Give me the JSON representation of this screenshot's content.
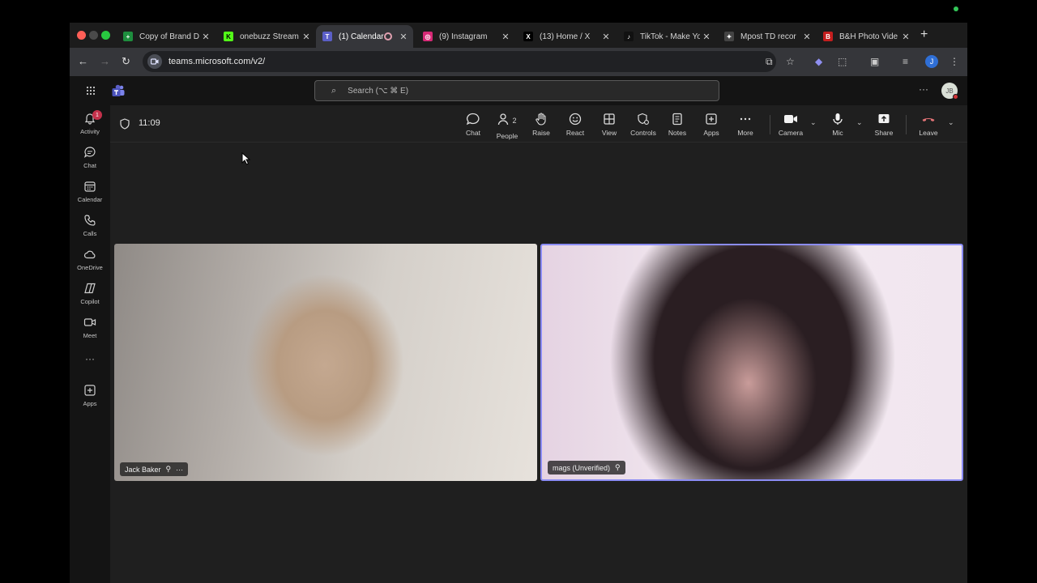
{
  "browser": {
    "tabs": [
      {
        "title": "Copy of Brand D",
        "favicon": "sheets-icon",
        "color": "#1e8e3e",
        "glyph": "+"
      },
      {
        "title": "onebuzz Stream",
        "favicon": "kick-icon",
        "color": "#53fc18",
        "glyph": "K"
      },
      {
        "title": "(1) Calendar",
        "favicon": "teams-icon",
        "color": "#5b5fc7",
        "glyph": "T",
        "active": true,
        "recording": true
      },
      {
        "title": "(9) Instagram",
        "favicon": "instagram-icon",
        "color": "#d62976",
        "glyph": "◎"
      },
      {
        "title": "(13) Home / X",
        "favicon": "x-icon",
        "color": "#000000",
        "glyph": "𝕏"
      },
      {
        "title": "TikTok - Make Yo",
        "favicon": "tiktok-icon",
        "color": "#111111",
        "glyph": "♪"
      },
      {
        "title": "Mpost TD recor",
        "favicon": "openai-icon",
        "color": "#444444",
        "glyph": "✦"
      },
      {
        "title": "B&H Photo Vide",
        "favicon": "bh-icon",
        "color": "#c41e1e",
        "glyph": "B"
      }
    ],
    "url": "teams.microsoft.com/v2/",
    "profile_initial": "J"
  },
  "teams": {
    "search_placeholder": "Search (⌥ ⌘ E)",
    "user_initials": "JB",
    "rail": [
      {
        "label": "Activity",
        "icon": "bell-icon",
        "badge": "1"
      },
      {
        "label": "Chat",
        "icon": "chat-icon"
      },
      {
        "label": "Calendar",
        "icon": "calendar-icon"
      },
      {
        "label": "Calls",
        "icon": "phone-icon"
      },
      {
        "label": "OneDrive",
        "icon": "cloud-icon"
      },
      {
        "label": "Copilot",
        "icon": "copilot-icon"
      },
      {
        "label": "Meet",
        "icon": "video-icon"
      },
      {
        "label": "Apps",
        "icon": "plus-box-icon"
      }
    ]
  },
  "meeting": {
    "elapsed": "11:09",
    "people_count": "2",
    "controls": {
      "chat": "Chat",
      "people": "People",
      "raise": "Raise",
      "react": "React",
      "view": "View",
      "controls": "Controls",
      "notes": "Notes",
      "apps": "Apps",
      "more": "More",
      "camera": "Camera",
      "mic": "Mic",
      "share": "Share",
      "leave": "Leave"
    },
    "participants": [
      {
        "name": "Jack Baker"
      },
      {
        "name": "mags (Unverified)"
      }
    ],
    "accent": "#8b8cf4",
    "leave_color": "#e37376"
  }
}
